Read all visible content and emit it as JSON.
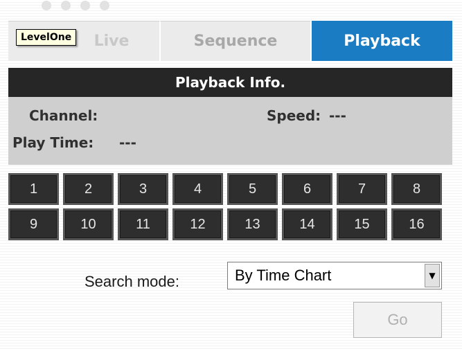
{
  "tabs": {
    "live_label": "Live",
    "sequence_label": "Sequence",
    "playback_label": "Playback",
    "active": "Playback",
    "active_color": "#1a7dc4"
  },
  "tooltip": {
    "text": "LevelOne"
  },
  "playback_info": {
    "title": "Playback Info.",
    "channel_label": "Channel:",
    "channel_value": "",
    "speed_label": "Speed:",
    "speed_value": "---",
    "play_time_label": "Play Time:",
    "play_time_value": "---"
  },
  "channels": [
    "1",
    "2",
    "3",
    "4",
    "5",
    "6",
    "7",
    "8",
    "9",
    "10",
    "11",
    "12",
    "13",
    "14",
    "15",
    "16"
  ],
  "search": {
    "label": "Search mode:",
    "selected": "By Time Chart",
    "dropdown_icon": "triangle-down"
  },
  "go_button": {
    "label": "Go",
    "enabled": false
  }
}
